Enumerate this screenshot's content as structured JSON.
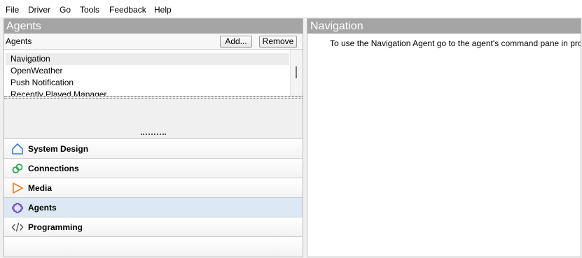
{
  "menu": [
    "File",
    "Driver",
    "Go",
    "Tools",
    "Feedback",
    "Help"
  ],
  "left_panel": {
    "title": "Agents",
    "toolbar_label": "Agents",
    "add_button": "Add...",
    "remove_button": "Remove",
    "agents": [
      "Navigation",
      "OpenWeather",
      "Push Notification",
      "Recently Played Manager"
    ],
    "selected_agent": "Navigation"
  },
  "navigation": [
    {
      "label": "System Design",
      "icon": "house-icon",
      "color": "#3c7fd6"
    },
    {
      "label": "Connections",
      "icon": "link-icon",
      "color": "#2eaa4a"
    },
    {
      "label": "Media",
      "icon": "play-icon",
      "color": "#f07d1e"
    },
    {
      "label": "Agents",
      "icon": "agents-icon",
      "color": "#6a2fc4",
      "active": true
    },
    {
      "label": "Programming",
      "icon": "code-icon",
      "color": "#555555"
    }
  ],
  "right_panel": {
    "title": "Navigation",
    "text": "To use the Navigation Agent go to the agent's command pane in programming"
  }
}
